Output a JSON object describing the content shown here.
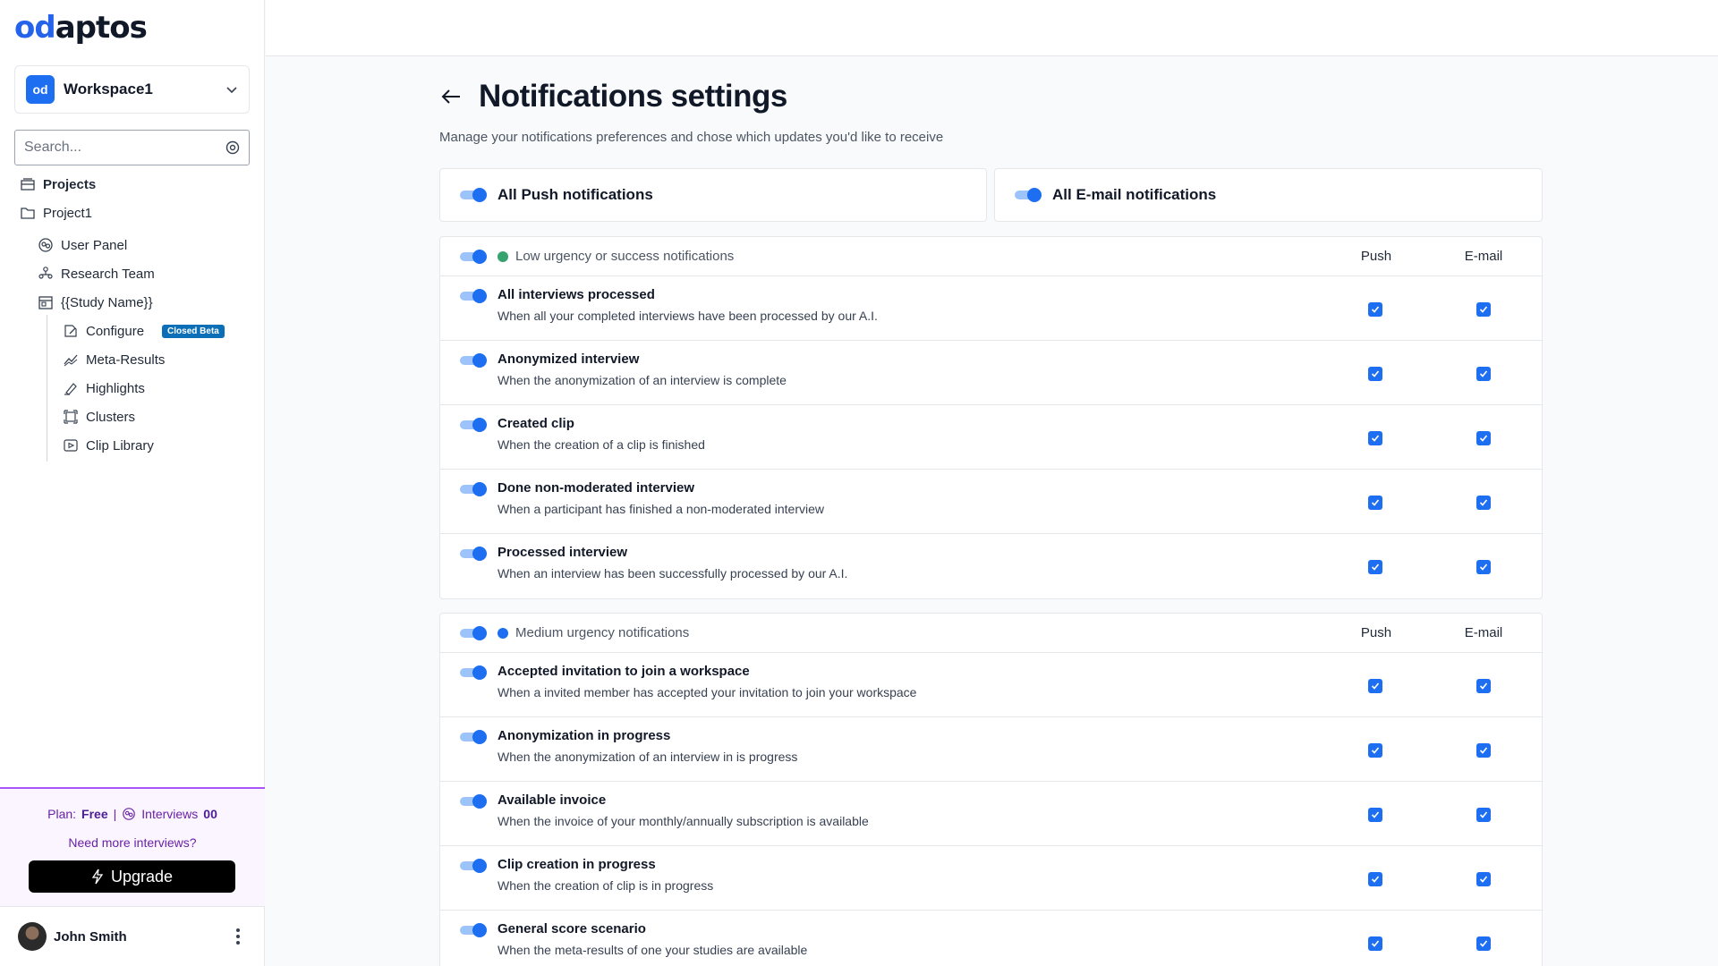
{
  "brand": {
    "logo_text_o": "od",
    "logo_text_rest": "aptos"
  },
  "workspace": {
    "icon_text": "od",
    "name": "Workspace1"
  },
  "search": {
    "placeholder": "Search..."
  },
  "nav": {
    "projects": "Projects",
    "project1": "Project1",
    "user_panel": "User Panel",
    "research_team": "Research Team",
    "study_name": "{{Study Name}}",
    "configure": "Configure",
    "configure_badge": "Closed Beta",
    "meta_results": "Meta-Results",
    "highlights": "Highlights",
    "clusters": "Clusters",
    "clip_library": "Clip Library"
  },
  "plan": {
    "plan_label": "Plan:",
    "plan_value": "Free",
    "separator": "|",
    "interviews_label": "Interviews",
    "interviews_value": "00",
    "need_more": "Need more interviews?",
    "upgrade_label": "Upgrade"
  },
  "user": {
    "name": "John Smith"
  },
  "page": {
    "title": "Notifications settings",
    "subtitle": "Manage your notifications preferences and chose which updates you'd like to receive",
    "all_push": "All Push notifications",
    "all_email": "All E-mail notifications"
  },
  "columns": {
    "push": "Push",
    "email": "E-mail"
  },
  "groups": [
    {
      "title": "Low urgency or success notifications",
      "dot_color": "#34a36d",
      "items": [
        {
          "name": "All interviews processed",
          "desc": "When all your completed interviews have been processed by our A.I."
        },
        {
          "name": "Anonymized interview",
          "desc": "When the anonymization of an interview is complete"
        },
        {
          "name": "Created clip",
          "desc": "When the creation of a clip is finished"
        },
        {
          "name": "Done non-moderated interview",
          "desc": "When a participant has finished a non-moderated interview"
        },
        {
          "name": "Processed interview",
          "desc": "When an interview has been successfully processed by our A.I."
        }
      ]
    },
    {
      "title": "Medium urgency notifications",
      "dot_color": "#1d6ef0",
      "items": [
        {
          "name": "Accepted invitation to join a workspace",
          "desc": "When a invited member has accepted your invitation to join your workspace"
        },
        {
          "name": "Anonymization in progress",
          "desc": "When the anonymization of an interview in is progress"
        },
        {
          "name": "Available invoice",
          "desc": "When the invoice of your monthly/annually subscription is available"
        },
        {
          "name": "Clip creation in progress",
          "desc": "When the creation of clip is in progress"
        },
        {
          "name": "General score scenario",
          "desc": "When the meta-results of one your studies are available"
        }
      ]
    }
  ],
  "colors": {
    "accent": "#1d6ef0",
    "plan_purple": "#6b21a8"
  }
}
